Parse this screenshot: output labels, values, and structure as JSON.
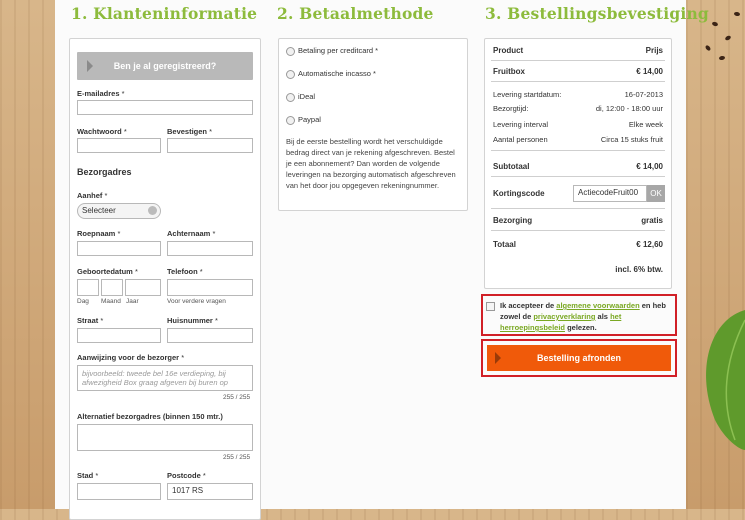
{
  "columns": {
    "col1_title": "1. Klanteninformatie",
    "col2_title": "2. Betaalmethode",
    "col3_title": "3. Bestellingsbevestiging"
  },
  "customer": {
    "registered_button": "Ben je al geregistreerd?",
    "email_label": "E-mailadres",
    "password_label": "Wachtwoord",
    "confirm_label": "Bevestigen",
    "address_heading": "Bezorgadres",
    "salutation_label": "Aanhef",
    "salutation_value": "Selecteer",
    "firstname_label": "Roepnaam",
    "lastname_label": "Achternaam",
    "birthdate_label": "Geboortedatum",
    "phone_label": "Telefoon",
    "day_label": "Dag",
    "month_label": "Maand",
    "year_label": "Jaar",
    "phone_hint": "Voor verdere vragen",
    "street_label": "Straat",
    "housenumber_label": "Huisnummer",
    "instructions_label": "Aanwijzing voor de bezorger",
    "instructions_placeholder": "bijvoorbeeld: tweede bel 16e verdieping, bij afwezigheid Box graag afgeven bij buren op",
    "instructions_count": "255 / 255",
    "alt_address_label": "Alternatief bezorgadres (binnen 150 mtr.)",
    "alt_address_count": "255 / 255",
    "city_label": "Stad",
    "postcode_label": "Postcode",
    "postcode_value": "1017 RS",
    "required_mark": "*"
  },
  "payment": {
    "options": [
      "Betaling per creditcard *",
      "Automatische incasso *",
      "iDeal",
      "Paypal"
    ],
    "note": "Bij de eerste bestelling wordt het verschuldigde bedrag direct van je rekening afgeschreven. Bestel je een abonnement? Dan worden de volgende leveringen na bezorging automatisch afgeschreven van het door jou opgegeven rekeningnummer."
  },
  "summary": {
    "header_product": "Product",
    "header_price": "Prijs",
    "product_name": "Fruitbox",
    "product_price": "€ 14,00",
    "start_label": "Levering startdatum:",
    "start_value": "16-07-2013",
    "time_label": "Bezorgtijd:",
    "time_value": "di, 12:00 - 18:00 uur",
    "interval_label": "Levering interval",
    "interval_value": "Elke week",
    "persons_label": "Aantal personen",
    "persons_value": "Circa 15 stuks fruit",
    "subtotal_label": "Subtotaal",
    "subtotal_value": "€ 14,00",
    "discount_label": "Kortingscode",
    "discount_value": "ActiecodeFruit00",
    "ok_label": "OK",
    "delivery_label": "Bezorging",
    "delivery_value": "gratis",
    "total_label": "Totaal",
    "total_value": "€ 12,60",
    "vat_note": "incl. 6% btw."
  },
  "terms": {
    "t1": "Ik accepteer de ",
    "link1": "algemene voorwaarden",
    "t2": " en heb zowel de ",
    "link2": "privacyverklaring",
    "t3": " als ",
    "link3": "het herroepingsbeleid",
    "t4": " gelezen."
  },
  "checkout": {
    "button_label": "Bestelling afronden"
  },
  "colors": {
    "accent_green": "#8dbb3c",
    "orange": "#f05a0a",
    "highlight_red": "#d12027"
  }
}
